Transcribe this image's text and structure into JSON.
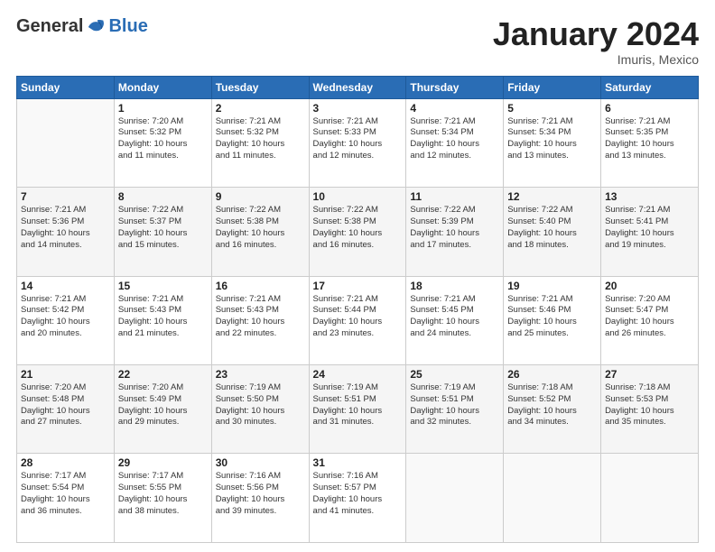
{
  "logo": {
    "general": "General",
    "blue": "Blue"
  },
  "header": {
    "month": "January 2024",
    "location": "Imuris, Mexico"
  },
  "weekdays": [
    "Sunday",
    "Monday",
    "Tuesday",
    "Wednesday",
    "Thursday",
    "Friday",
    "Saturday"
  ],
  "weeks": [
    [
      {
        "day": "",
        "empty": true
      },
      {
        "day": "1",
        "sunrise": "7:20 AM",
        "sunset": "5:32 PM",
        "daylight": "10 hours and 11 minutes."
      },
      {
        "day": "2",
        "sunrise": "7:21 AM",
        "sunset": "5:32 PM",
        "daylight": "10 hours and 11 minutes."
      },
      {
        "day": "3",
        "sunrise": "7:21 AM",
        "sunset": "5:33 PM",
        "daylight": "10 hours and 12 minutes."
      },
      {
        "day": "4",
        "sunrise": "7:21 AM",
        "sunset": "5:34 PM",
        "daylight": "10 hours and 12 minutes."
      },
      {
        "day": "5",
        "sunrise": "7:21 AM",
        "sunset": "5:34 PM",
        "daylight": "10 hours and 13 minutes."
      },
      {
        "day": "6",
        "sunrise": "7:21 AM",
        "sunset": "5:35 PM",
        "daylight": "10 hours and 13 minutes."
      }
    ],
    [
      {
        "day": "7",
        "sunrise": "7:21 AM",
        "sunset": "5:36 PM",
        "daylight": "10 hours and 14 minutes."
      },
      {
        "day": "8",
        "sunrise": "7:22 AM",
        "sunset": "5:37 PM",
        "daylight": "10 hours and 15 minutes."
      },
      {
        "day": "9",
        "sunrise": "7:22 AM",
        "sunset": "5:38 PM",
        "daylight": "10 hours and 16 minutes."
      },
      {
        "day": "10",
        "sunrise": "7:22 AM",
        "sunset": "5:38 PM",
        "daylight": "10 hours and 16 minutes."
      },
      {
        "day": "11",
        "sunrise": "7:22 AM",
        "sunset": "5:39 PM",
        "daylight": "10 hours and 17 minutes."
      },
      {
        "day": "12",
        "sunrise": "7:22 AM",
        "sunset": "5:40 PM",
        "daylight": "10 hours and 18 minutes."
      },
      {
        "day": "13",
        "sunrise": "7:21 AM",
        "sunset": "5:41 PM",
        "daylight": "10 hours and 19 minutes."
      }
    ],
    [
      {
        "day": "14",
        "sunrise": "7:21 AM",
        "sunset": "5:42 PM",
        "daylight": "10 hours and 20 minutes."
      },
      {
        "day": "15",
        "sunrise": "7:21 AM",
        "sunset": "5:43 PM",
        "daylight": "10 hours and 21 minutes."
      },
      {
        "day": "16",
        "sunrise": "7:21 AM",
        "sunset": "5:43 PM",
        "daylight": "10 hours and 22 minutes."
      },
      {
        "day": "17",
        "sunrise": "7:21 AM",
        "sunset": "5:44 PM",
        "daylight": "10 hours and 23 minutes."
      },
      {
        "day": "18",
        "sunrise": "7:21 AM",
        "sunset": "5:45 PM",
        "daylight": "10 hours and 24 minutes."
      },
      {
        "day": "19",
        "sunrise": "7:21 AM",
        "sunset": "5:46 PM",
        "daylight": "10 hours and 25 minutes."
      },
      {
        "day": "20",
        "sunrise": "7:20 AM",
        "sunset": "5:47 PM",
        "daylight": "10 hours and 26 minutes."
      }
    ],
    [
      {
        "day": "21",
        "sunrise": "7:20 AM",
        "sunset": "5:48 PM",
        "daylight": "10 hours and 27 minutes."
      },
      {
        "day": "22",
        "sunrise": "7:20 AM",
        "sunset": "5:49 PM",
        "daylight": "10 hours and 29 minutes."
      },
      {
        "day": "23",
        "sunrise": "7:19 AM",
        "sunset": "5:50 PM",
        "daylight": "10 hours and 30 minutes."
      },
      {
        "day": "24",
        "sunrise": "7:19 AM",
        "sunset": "5:51 PM",
        "daylight": "10 hours and 31 minutes."
      },
      {
        "day": "25",
        "sunrise": "7:19 AM",
        "sunset": "5:51 PM",
        "daylight": "10 hours and 32 minutes."
      },
      {
        "day": "26",
        "sunrise": "7:18 AM",
        "sunset": "5:52 PM",
        "daylight": "10 hours and 34 minutes."
      },
      {
        "day": "27",
        "sunrise": "7:18 AM",
        "sunset": "5:53 PM",
        "daylight": "10 hours and 35 minutes."
      }
    ],
    [
      {
        "day": "28",
        "sunrise": "7:17 AM",
        "sunset": "5:54 PM",
        "daylight": "10 hours and 36 minutes."
      },
      {
        "day": "29",
        "sunrise": "7:17 AM",
        "sunset": "5:55 PM",
        "daylight": "10 hours and 38 minutes."
      },
      {
        "day": "30",
        "sunrise": "7:16 AM",
        "sunset": "5:56 PM",
        "daylight": "10 hours and 39 minutes."
      },
      {
        "day": "31",
        "sunrise": "7:16 AM",
        "sunset": "5:57 PM",
        "daylight": "10 hours and 41 minutes."
      },
      {
        "day": "",
        "empty": true
      },
      {
        "day": "",
        "empty": true
      },
      {
        "day": "",
        "empty": true
      }
    ]
  ],
  "labels": {
    "sunrise": "Sunrise:",
    "sunset": "Sunset:",
    "daylight": "Daylight:"
  }
}
